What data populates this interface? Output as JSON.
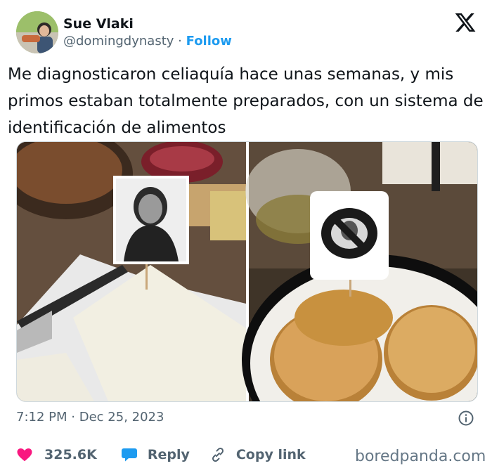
{
  "author": {
    "display_name": "Sue Vlaki",
    "handle": "@domingdynasty",
    "separator": "·",
    "follow_label": "Follow"
  },
  "tweet": {
    "text": "Me diagnosticaron celiaquía hace unas semanas, y mis primos estaban totalmente preparados, con un sistema de identificación de alimentos",
    "time": "7:12 PM",
    "date_separator": "·",
    "date": "Dec 25, 2023"
  },
  "actions": {
    "likes_count": "325.6K",
    "reply_label": "Reply",
    "copy_link_label": "Copy link"
  },
  "watermark": "boredpanda.com",
  "icons": {
    "brand": "x-logo-icon",
    "info": "info-icon",
    "like": "heart-icon",
    "reply": "speech-bubble-icon",
    "copy": "link-icon"
  },
  "colors": {
    "follow": "#1d9bf0",
    "heart": "#f91880",
    "reply_bubble": "#1d9bf0",
    "muted_text": "#536471"
  }
}
